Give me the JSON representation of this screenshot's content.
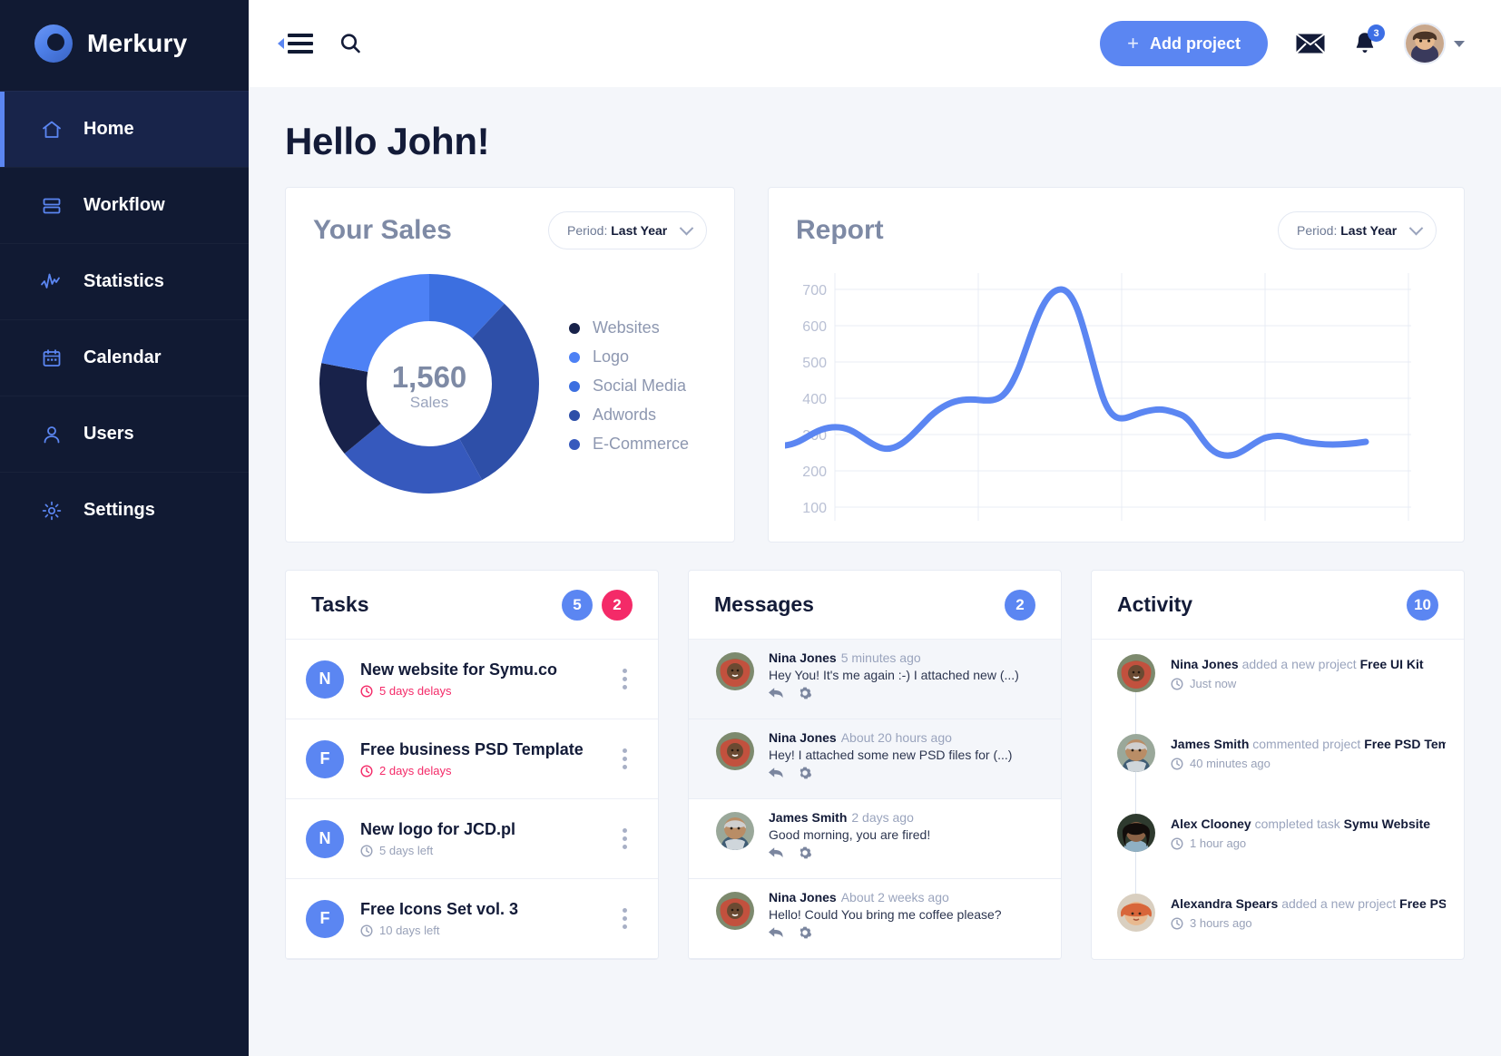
{
  "brand": {
    "name": "Merkury",
    "logo_icon": "merkury-ring-logo"
  },
  "sidebar": {
    "items": [
      {
        "label": "Home",
        "icon": "home-icon",
        "active": true
      },
      {
        "label": "Workflow",
        "icon": "workflow-icon",
        "active": false
      },
      {
        "label": "Statistics",
        "icon": "statistics-icon",
        "active": false
      },
      {
        "label": "Calendar",
        "icon": "calendar-icon",
        "active": false
      },
      {
        "label": "Users",
        "icon": "users-icon",
        "active": false
      },
      {
        "label": "Settings",
        "icon": "settings-gear-icon",
        "active": false
      }
    ]
  },
  "topbar": {
    "menu_icon": "hamburger-collapse-icon",
    "search_icon": "search-icon",
    "add_project_label": "Add project",
    "add_project_plus": "+",
    "mail_icon": "mail-icon",
    "bell_icon": "bell-icon",
    "bell_badge": "3",
    "avatar_icon": "user-avatar",
    "caret_icon": "chevron-down-icon"
  },
  "page": {
    "greeting": "Hello John!"
  },
  "sales": {
    "title": "Your Sales",
    "period_prefix": "Period:",
    "period_value": "Last Year",
    "center_value": "1,560",
    "center_label": "Sales"
  },
  "report": {
    "title": "Report",
    "period_prefix": "Period:",
    "period_value": "Last Year"
  },
  "chart_data": [
    {
      "type": "pie",
      "title": "Your Sales",
      "legend_position": "right",
      "center_value": "1,560",
      "center_label": "Sales",
      "total": 1560,
      "categories": [
        "Websites",
        "Logo",
        "Social Media",
        "Adwords",
        "E-Commerce"
      ],
      "values": [
        14,
        22,
        12,
        30,
        22
      ],
      "colors": [
        "#18224a",
        "#4d81f5",
        "#3c6fe0",
        "#2e4fa8",
        "#3659bd"
      ],
      "segment_order_from_top_clockwise": [
        "Social Media",
        "Adwords",
        "E-Commerce",
        "Websites",
        "Logo"
      ]
    },
    {
      "type": "line",
      "title": "Report",
      "xlabel": "",
      "ylabel": "",
      "ylim": [
        50,
        750
      ],
      "yticks": [
        100,
        200,
        300,
        400,
        500,
        600,
        700
      ],
      "grid": true,
      "line_color": "#5b86f2",
      "x": [
        0,
        1,
        2,
        3,
        4,
        5,
        6,
        7,
        8,
        9,
        10,
        11,
        12
      ],
      "values": [
        270,
        320,
        255,
        390,
        370,
        700,
        340,
        390,
        265,
        305,
        290,
        280,
        285
      ]
    }
  ],
  "tasks": {
    "title": "Tasks",
    "badges": [
      {
        "value": "5",
        "color": "blue"
      },
      {
        "value": "2",
        "color": "pink"
      }
    ],
    "menu_icon": "more-vertical-icon",
    "items": [
      {
        "initial": "N",
        "title": "New website for Symu.co",
        "meta": "5 days delays",
        "status": "delay",
        "clock_icon": "clock-icon"
      },
      {
        "initial": "F",
        "title": "Free business PSD Template",
        "meta": "2 days delays",
        "status": "delay",
        "clock_icon": "clock-icon"
      },
      {
        "initial": "N",
        "title": "New logo for JCD.pl",
        "meta": "5 days left",
        "status": "left",
        "clock_icon": "clock-icon"
      },
      {
        "initial": "F",
        "title": "Free Icons Set vol. 3",
        "meta": "10 days left",
        "status": "left",
        "clock_icon": "clock-icon"
      }
    ]
  },
  "messages": {
    "title": "Messages",
    "badges": [
      {
        "value": "2",
        "color": "blue"
      }
    ],
    "reply_icon": "reply-icon",
    "settings_icon": "gear-icon",
    "items": [
      {
        "name": "Nina Jones",
        "time": "5 minutes ago",
        "text": "Hey You! It's me again :-) I attached new (...)",
        "unread": true,
        "avatar": "nina-avatar"
      },
      {
        "name": "Nina Jones",
        "time": "About 20 hours ago",
        "text": "Hey! I attached some new PSD files for (...)",
        "unread": true,
        "avatar": "nina-avatar"
      },
      {
        "name": "James Smith",
        "time": "2 days ago",
        "text": "Good morning, you are fired!",
        "unread": false,
        "avatar": "james-avatar"
      },
      {
        "name": "Nina Jones",
        "time": "About 2 weeks ago",
        "text": "Hello! Could You bring me coffee please?",
        "unread": false,
        "avatar": "nina-avatar"
      }
    ]
  },
  "activity": {
    "title": "Activity",
    "badges": [
      {
        "value": "10",
        "color": "blue"
      }
    ],
    "clock_icon": "clock-icon",
    "items": [
      {
        "name": "Nina Jones",
        "action": "added a new project",
        "target": "Free UI Kit",
        "time": "Just now",
        "avatar": "nina-avatar"
      },
      {
        "name": "James Smith",
        "action": "commented project",
        "target": "Free PSD Template",
        "time": "40 minutes ago",
        "avatar": "james-avatar"
      },
      {
        "name": "Alex Clooney",
        "action": "completed task",
        "target": "Symu Website",
        "time": "1 hour ago",
        "avatar": "alex-avatar"
      },
      {
        "name": "Alexandra Spears",
        "action": "added a new project",
        "target": "Free PSD (...)",
        "time": "3 hours ago",
        "avatar": "alexandra-avatar"
      }
    ]
  },
  "colors": {
    "accent": "#5b86f2",
    "danger": "#f42a68",
    "sidebar_bg": "#111a33",
    "page_bg": "#f4f6fa",
    "text_dark": "#131b38",
    "text_muted": "#9aa4bd"
  }
}
